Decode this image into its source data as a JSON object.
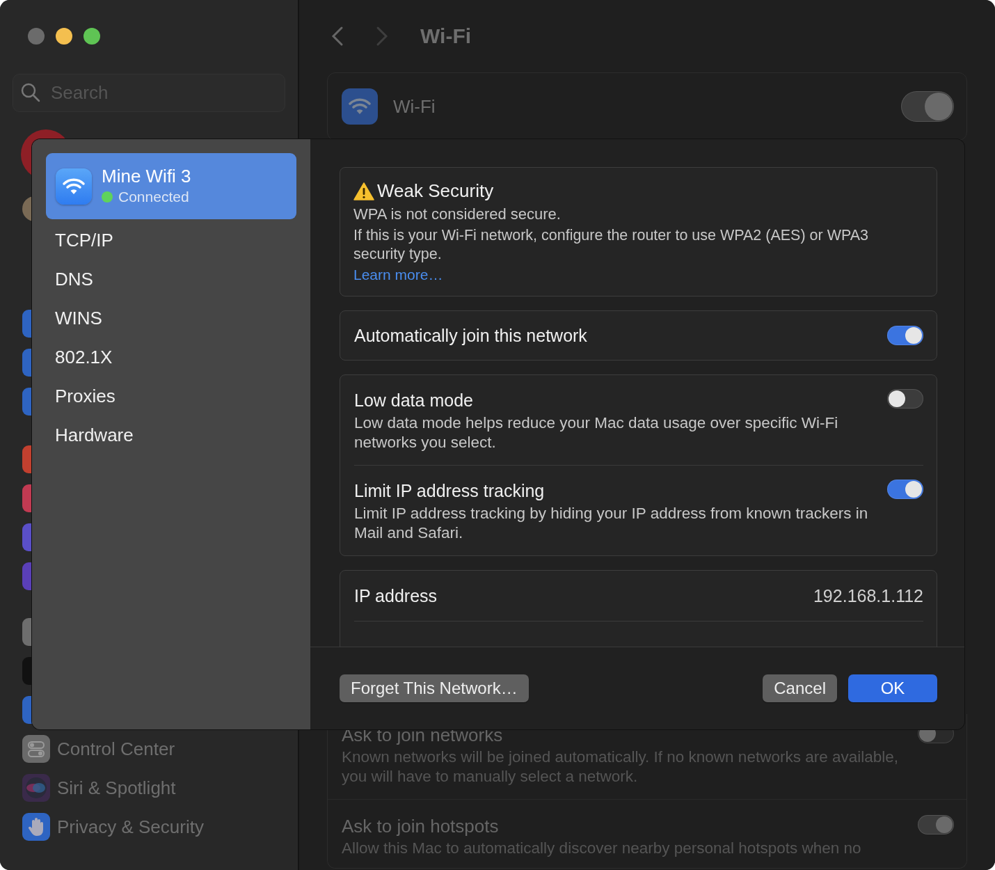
{
  "window": {
    "controls": [
      {
        "color": "#6b6b6b"
      },
      {
        "color": "#f4bf4f"
      },
      {
        "color": "#5fc454"
      }
    ]
  },
  "sidebar": {
    "search": {
      "placeholder": "Search"
    },
    "covered_top": [
      {
        "color": "#8e1f26"
      },
      {
        "color": "#7a6a55"
      }
    ],
    "covered_items": [
      {
        "color": "#2e64c2"
      },
      {
        "color": "#2e64c2"
      },
      {
        "color": "#2e64c2"
      },
      {
        "color": "#c2402f"
      },
      {
        "color": "#c23a52"
      },
      {
        "color": "#5a4fc8"
      },
      {
        "color": "#5a3fb8"
      },
      {
        "color": "#6e6e6e"
      },
      {
        "color": "#111111"
      },
      {
        "color": "#2e64c2"
      }
    ],
    "items": [
      {
        "label": "Control Center",
        "kind": "toggles",
        "color": "#6a6a6a"
      },
      {
        "label": "Siri & Spotlight",
        "kind": "siri",
        "color": "#3a2a4a"
      },
      {
        "label": "Privacy & Security",
        "kind": "hand",
        "color": "#2e64c2"
      }
    ]
  },
  "main": {
    "title": "Wi-Fi",
    "wifi": {
      "label": "Wi-Fi",
      "on": true
    },
    "settings": [
      {
        "title": "Ask to join networks",
        "description": "Known networks will be joined automatically. If no known networks are available, you will have to manually select a network.",
        "on": false
      },
      {
        "title": "Ask to join hotspots",
        "description": "Allow this Mac to automatically discover nearby personal hotspots when no",
        "on": true
      }
    ]
  },
  "sheet": {
    "network": {
      "name": "Mine Wifi 3",
      "status": "Connected",
      "connected": true,
      "selected": true
    },
    "tabs": [
      {
        "label": "TCP/IP",
        "selected": false
      },
      {
        "label": "DNS",
        "selected": false
      },
      {
        "label": "WINS",
        "selected": false
      },
      {
        "label": "802.1X",
        "selected": false
      },
      {
        "label": "Proxies",
        "selected": false
      },
      {
        "label": "Hardware",
        "selected": false
      }
    ],
    "warning": {
      "title": "Weak Security",
      "lines": [
        "WPA is not considered secure.",
        "If this is your Wi-Fi network, configure the router to use WPA2 (AES) or WPA3 security type."
      ],
      "link": "Learn more…"
    },
    "auto_join": {
      "label": "Automatically join this network",
      "on": true
    },
    "options": [
      {
        "title": "Low data mode",
        "description": "Low data mode helps reduce your Mac data usage over specific Wi-Fi networks you select.",
        "on": false
      },
      {
        "title": "Limit IP address tracking",
        "description": "Limit IP address tracking by hiding your IP address from known trackers in Mail and Safari.",
        "on": true
      }
    ],
    "info": [
      {
        "label": "IP address",
        "value": "192.168.1.112"
      }
    ],
    "buttons": [
      {
        "label": "Forget This Network…",
        "kind": "secondary"
      },
      {
        "label": "Cancel",
        "kind": "secondary"
      },
      {
        "label": "OK",
        "kind": "primary"
      }
    ]
  }
}
